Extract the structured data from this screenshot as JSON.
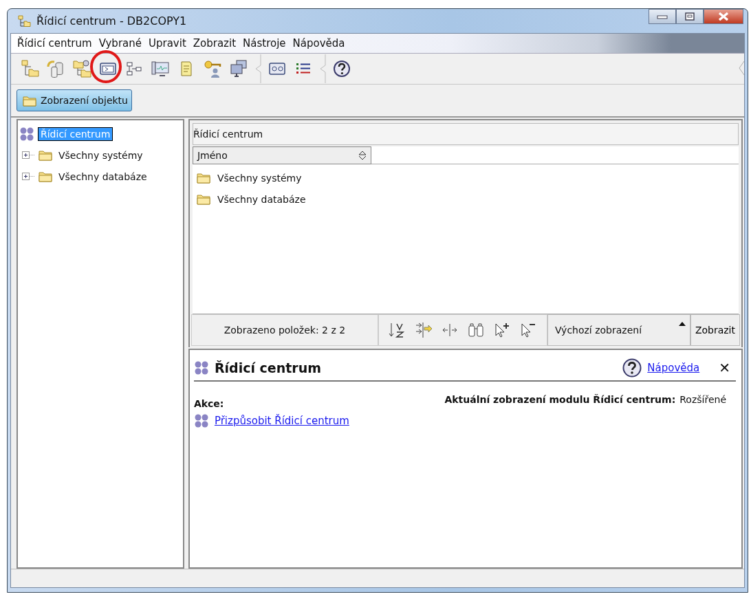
{
  "window": {
    "title": "Řídicí centrum - DB2COPY1"
  },
  "menu": [
    "Řídicí centrum",
    "Vybrané",
    "Upravit",
    "Zobrazit",
    "Nástroje",
    "Nápověda"
  ],
  "toolbar": [
    {
      "circled": false
    },
    {
      "circled": false
    },
    {
      "circled": false
    },
    {
      "circled": true
    },
    {
      "circled": false
    },
    {
      "circled": false
    },
    {
      "circled": false
    },
    {
      "circled": false
    },
    {
      "circled": false
    },
    {
      "circled": false
    },
    {
      "circled": false
    },
    {
      "circled": false
    }
  ],
  "view_tabs": [
    {
      "label": "Zobrazení objektu",
      "selected": true
    }
  ],
  "tree": [
    {
      "label": "Řídicí centrum",
      "selected": true,
      "children": [
        {
          "label": "Všechny systémy",
          "selected": false,
          "expanded": false
        },
        {
          "label": "Všechny databáze",
          "selected": false,
          "expanded": false
        }
      ]
    }
  ],
  "list": {
    "path": "Řídicí centrum",
    "columns": [
      "Jméno"
    ],
    "rows": [
      {
        "name": "Všechny systémy"
      },
      {
        "name": "Všechny databáze"
      }
    ],
    "count": "Zobrazeno položek: 2 z 2",
    "view_select": "Výchozí zobrazení",
    "view_button": "Zobrazit"
  },
  "info": {
    "title": "Řídicí centrum",
    "help_link": "Nápověda",
    "close": "✕",
    "actions_label": "Akce:",
    "actions": [
      "Přizpůsobit Řídicí centrum"
    ],
    "view_label": "Aktuální zobrazení modulu Řídicí centrum:",
    "view_value": "Rozšířené"
  }
}
